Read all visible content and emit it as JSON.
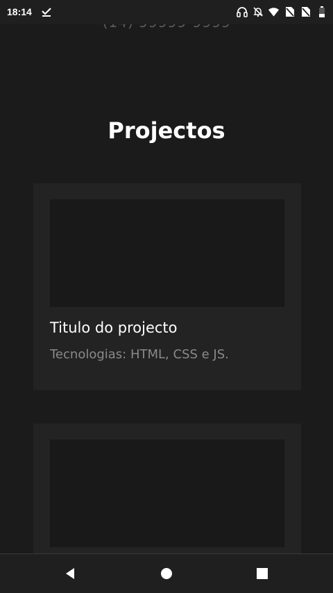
{
  "status_bar": {
    "time": "18:14",
    "left_icon": "check-download-icon",
    "right_icons": [
      "headphones-icon",
      "bell-off-icon",
      "wifi-icon",
      "no-sim-icon",
      "no-sim-icon",
      "battery-icon"
    ]
  },
  "page": {
    "phone_partial": "(14) 99999-9999",
    "section_title": "Projectos",
    "projects": [
      {
        "title": "Titulo do projecto",
        "tech": "Tecnologias: HTML, CSS e JS."
      },
      {
        "title": "",
        "tech": ""
      }
    ]
  },
  "nav_bar": {
    "back": "back-icon",
    "home": "home-icon",
    "recents": "recents-icon"
  },
  "colors": {
    "background": "#1b1b1b",
    "card": "#232323",
    "card_image": "#191919",
    "text_primary": "#ffffff",
    "text_secondary": "#8a8a8a"
  }
}
